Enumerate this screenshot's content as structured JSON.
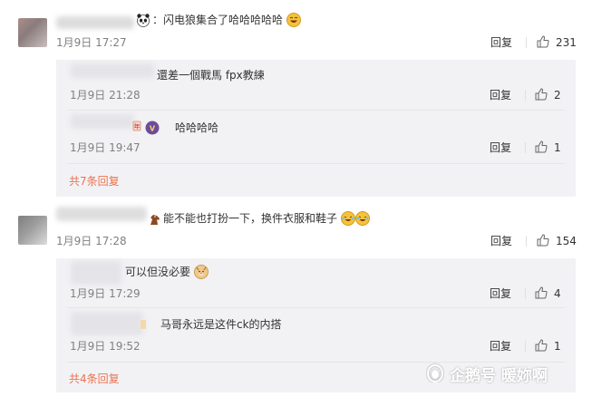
{
  "comments": [
    {
      "text": "闪电狼集合了哈哈哈哈哈",
      "date": "1月9日 17:27",
      "reply_label": "回复",
      "likes": "231",
      "replies": [
        {
          "text": "還差一個戰馬 fpx教練",
          "date": "1月9日 21:28",
          "reply_label": "回复",
          "likes": "2"
        },
        {
          "text": "哈哈哈哈",
          "date": "1月9日 19:47",
          "reply_label": "回复",
          "likes": "1"
        }
      ],
      "more_replies": "共7条回复"
    },
    {
      "text": "能不能也打扮一下，换件衣服和鞋子",
      "date": "1月9日 17:28",
      "reply_label": "回复",
      "likes": "154",
      "replies": [
        {
          "text": "可以但没必要",
          "date": "1月9日 17:29",
          "reply_label": "回复",
          "likes": "4"
        },
        {
          "text": "马哥永远是这件ck的内搭",
          "date": "1月9日 19:52",
          "reply_label": "回复",
          "likes": "1"
        }
      ],
      "more_replies": "共4条回复"
    }
  ],
  "watermark": "企鹅号 暖妳啊",
  "colors": {
    "accent": "#eb7350",
    "panel": "#f2f2f5",
    "muted": "#808080"
  }
}
